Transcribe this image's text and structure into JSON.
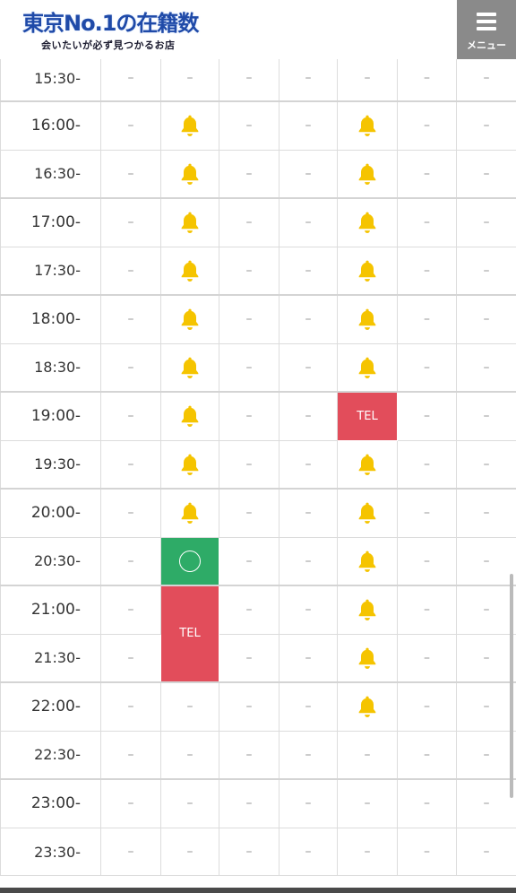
{
  "header": {
    "logo_title": "東京No.1の在籍数",
    "logo_subtitle": "会いたいが必ず見つかるお店",
    "menu_label": "メニュー"
  },
  "schedule": {
    "dash": "–",
    "tel_label": "TEL",
    "status_icons": {
      "bell": "bell-icon",
      "circle": "available-circle-icon"
    },
    "colors": {
      "tel": "#e24d5b",
      "available": "#2eab67",
      "bell": "#f5c400"
    },
    "rows": [
      {
        "time": "15:30-",
        "cells": [
          "-",
          "-",
          "-",
          "-",
          "-",
          "-",
          "-"
        ]
      },
      {
        "time": "16:00-",
        "cells": [
          "-",
          "bell",
          "-",
          "-",
          "bell",
          "-",
          "-"
        ]
      },
      {
        "time": "16:30-",
        "cells": [
          "-",
          "bell",
          "-",
          "-",
          "bell",
          "-",
          "-"
        ]
      },
      {
        "time": "17:00-",
        "cells": [
          "-",
          "bell",
          "-",
          "-",
          "bell",
          "-",
          "-"
        ]
      },
      {
        "time": "17:30-",
        "cells": [
          "-",
          "bell",
          "-",
          "-",
          "bell",
          "-",
          "-"
        ]
      },
      {
        "time": "18:00-",
        "cells": [
          "-",
          "bell",
          "-",
          "-",
          "bell",
          "-",
          "-"
        ]
      },
      {
        "time": "18:30-",
        "cells": [
          "-",
          "bell",
          "-",
          "-",
          "bell",
          "-",
          "-"
        ]
      },
      {
        "time": "19:00-",
        "cells": [
          "-",
          "bell",
          "-",
          "-",
          "TEL",
          "-",
          "-"
        ]
      },
      {
        "time": "19:30-",
        "cells": [
          "-",
          "bell",
          "-",
          "-",
          "bell",
          "-",
          "-"
        ]
      },
      {
        "time": "20:00-",
        "cells": [
          "-",
          "bell",
          "-",
          "-",
          "bell",
          "-",
          "-"
        ]
      },
      {
        "time": "20:30-",
        "cells": [
          "-",
          "circle",
          "-",
          "-",
          "bell",
          "-",
          "-"
        ]
      },
      {
        "time": "21:00-",
        "cells": [
          "-",
          "TEL2",
          "-",
          "-",
          "bell",
          "-",
          "-"
        ]
      },
      {
        "time": "21:30-",
        "cells": [
          "-",
          "merged",
          "-",
          "-",
          "bell",
          "-",
          "-"
        ]
      },
      {
        "time": "22:00-",
        "cells": [
          "-",
          "-",
          "-",
          "-",
          "bell",
          "-",
          "-"
        ]
      },
      {
        "time": "22:30-",
        "cells": [
          "-",
          "-",
          "-",
          "-",
          "-",
          "-",
          "-"
        ]
      },
      {
        "time": "23:00-",
        "cells": [
          "-",
          "-",
          "-",
          "-",
          "-",
          "-",
          "-"
        ]
      },
      {
        "time": "23:30-",
        "cells": [
          "-",
          "-",
          "-",
          "-",
          "-",
          "-",
          "-"
        ]
      }
    ]
  }
}
